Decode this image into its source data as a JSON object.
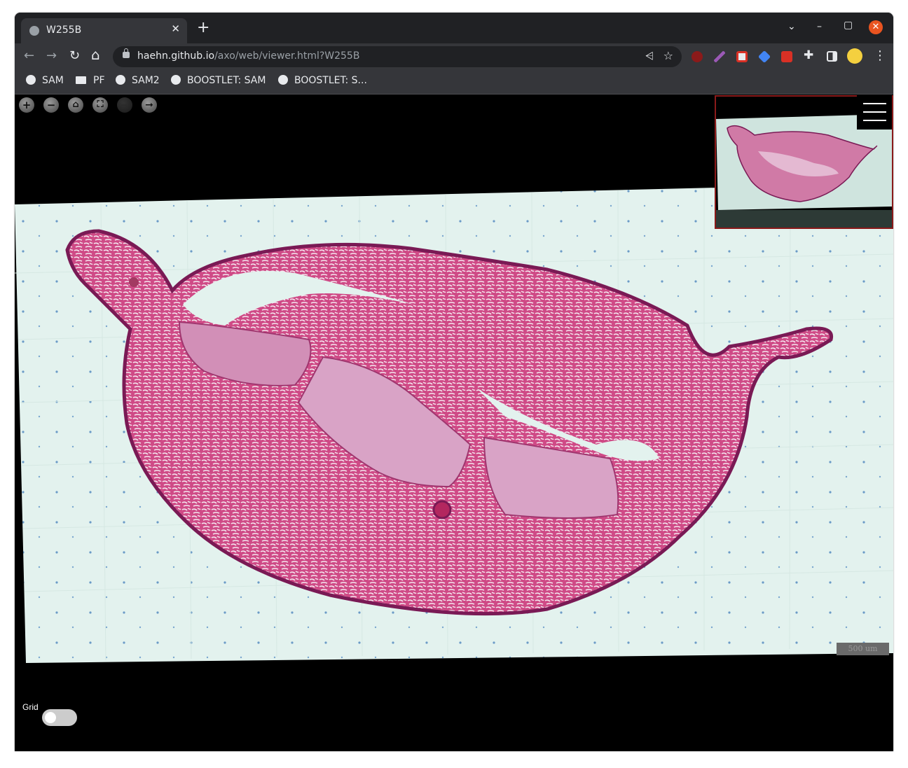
{
  "browser": {
    "tab": {
      "title": "W255B",
      "close": "✕"
    },
    "new_tab": "+",
    "window_controls": {
      "tab_search": "⌄",
      "minimize": "–",
      "maximize": "▢",
      "close": "✕"
    },
    "nav": {
      "back": "←",
      "forward": "→",
      "reload": "↻",
      "home": "⌂"
    },
    "address": {
      "host": "haehn.github.io",
      "path": "/axo/web/viewer.html?W255B"
    },
    "omnibox_icons": {
      "share": "share-icon",
      "star": "☆"
    },
    "bookmarks": [
      {
        "label": "SAM",
        "icon": "globe-icon"
      },
      {
        "label": "PF",
        "icon": "folder-icon"
      },
      {
        "label": "SAM2",
        "icon": "globe-icon"
      },
      {
        "label": "BOOSTLET: SAM",
        "icon": "globe-icon"
      },
      {
        "label": "BOOSTLET: S...",
        "icon": "globe-icon"
      }
    ],
    "menu": "⋮"
  },
  "viewer": {
    "controls": {
      "zoom_in": "+",
      "zoom_out": "−",
      "home": "⌂",
      "fullpage": "⛶",
      "previous": "−",
      "next": "➞"
    },
    "scale_bar": "500 um",
    "grid_label": "Grid",
    "grid_enabled": false,
    "colors": {
      "tissue": "#c8457a",
      "background": "#e3f2ee",
      "cartilage": "#d9a3c6",
      "navigator_border": "#8b1a1a"
    }
  }
}
